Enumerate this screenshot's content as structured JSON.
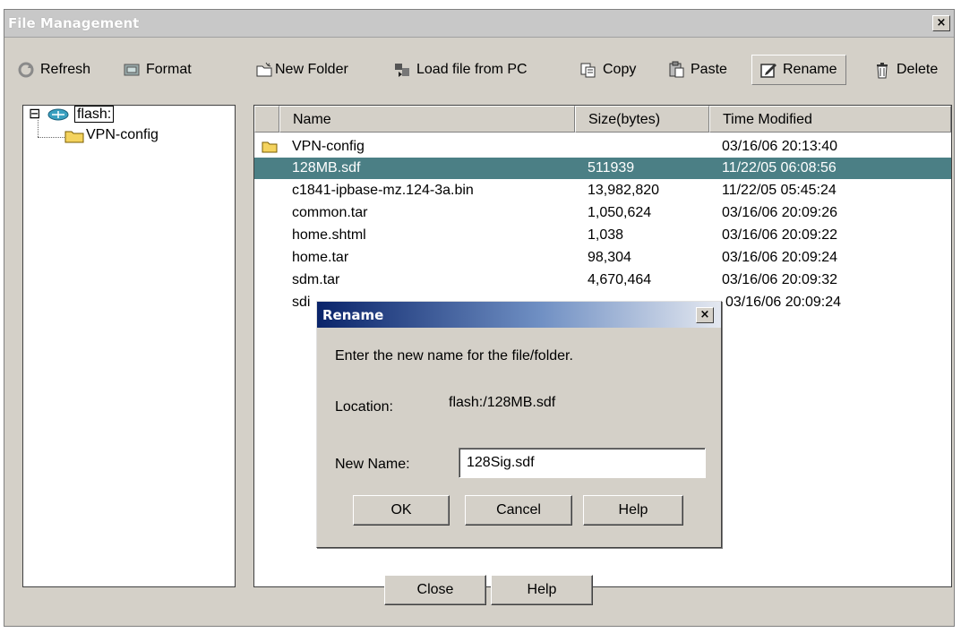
{
  "window": {
    "title": "File Management",
    "close_glyph": "×"
  },
  "toolbar": {
    "refresh": "Refresh",
    "format": "Format",
    "new_folder": "New Folder",
    "load_file": "Load file from PC",
    "copy": "Copy",
    "paste": "Paste",
    "rename": "Rename",
    "delete": "Delete"
  },
  "tree": {
    "expander": "⊟",
    "root_label": "flash:",
    "child_label": "VPN-config"
  },
  "table": {
    "headers": [
      "Name",
      "Size(bytes)",
      "Time Modified"
    ],
    "rows": [
      {
        "name": "VPN-config",
        "size": "",
        "time": "03/16/06 20:13:40",
        "folder": true
      },
      {
        "name": "128MB.sdf",
        "size": "511939",
        "time": "11/22/05 06:08:56",
        "selected": true
      },
      {
        "name": "c1841-ipbase-mz.124-3a.bin",
        "size": "13,982,820",
        "time": "11/22/05 05:45:24"
      },
      {
        "name": "common.tar",
        "size": "1,050,624",
        "time": "03/16/06 20:09:26"
      },
      {
        "name": "home.shtml",
        "size": "1,038",
        "time": "03/16/06 20:09:22"
      },
      {
        "name": "home.tar",
        "size": "98,304",
        "time": "03/16/06 20:09:24"
      },
      {
        "name": "sdm.tar",
        "size": "4,670,464",
        "time": "03/16/06 20:09:32"
      },
      {
        "name": "sdi",
        "size": "",
        "time": "03/16/06 20:09:24"
      }
    ]
  },
  "dialog": {
    "title": "Rename",
    "close_glyph": "×",
    "prompt": "Enter the new name for the file/folder.",
    "location_label": "Location:",
    "location_value": "flash:/128MB.sdf",
    "new_name_label": "New Name:",
    "new_name_value": "128Sig.sdf",
    "ok": "OK",
    "cancel": "Cancel",
    "help": "Help"
  },
  "footer": {
    "close": "Close",
    "help": "Help"
  },
  "colors": {
    "selection": "#4b7f85",
    "window_bg": "#d4d0c8",
    "dialog_title": "#0a246a"
  }
}
